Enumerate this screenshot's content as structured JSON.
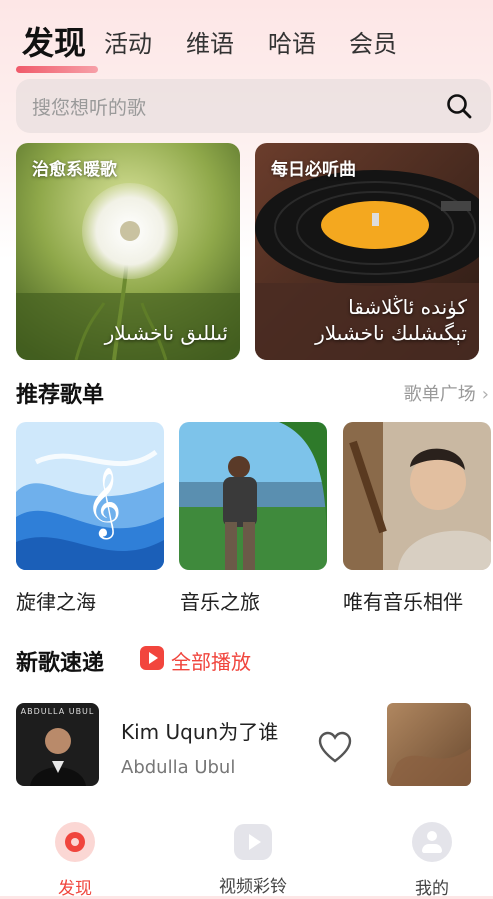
{
  "tabs": [
    {
      "label": "发现",
      "active": true
    },
    {
      "label": "活动",
      "active": false
    },
    {
      "label": "维语",
      "active": false
    },
    {
      "label": "哈语",
      "active": false
    },
    {
      "label": "会员",
      "active": false
    }
  ],
  "search": {
    "placeholder": "搜您想听的歌",
    "icon": "search-icon"
  },
  "banners": [
    {
      "title": "治愈系暖歌",
      "subtitle": "ئىللىق ناخشىلار"
    },
    {
      "title": "每日必听曲",
      "subtitle": "كۈندە ئاڭلاشقا تېگىشلىك ناخشىلار"
    }
  ],
  "recommend": {
    "title": "推荐歌单",
    "more_label": "歌单广场",
    "playlists": [
      {
        "label": "旋律之海"
      },
      {
        "label": "音乐之旅"
      },
      {
        "label": "唯有音乐相伴"
      }
    ]
  },
  "new_songs": {
    "title": "新歌速递",
    "play_all_label": "全部播放",
    "songs": [
      {
        "title": "Kim Uqun为了谁",
        "artist": "Abdulla Ubul",
        "cover_text": "ABDULLA UBUL"
      }
    ]
  },
  "bottom_nav": [
    {
      "label": "发现",
      "active": true,
      "icon": "discover-icon"
    },
    {
      "label": "视频彩铃",
      "active": false,
      "icon": "video-play-icon"
    },
    {
      "label": "我的",
      "active": false,
      "icon": "profile-icon"
    }
  ],
  "colors": {
    "accent": "#f0453d",
    "tab_underline": "#f05a6a"
  }
}
